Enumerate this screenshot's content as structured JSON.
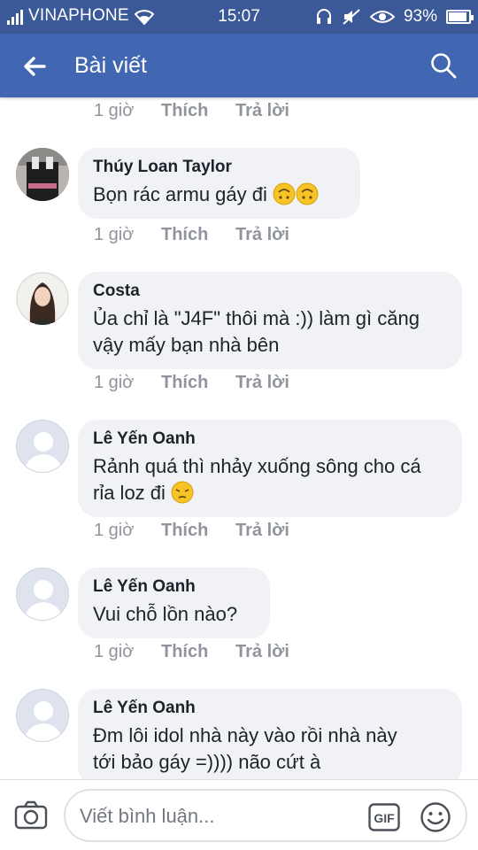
{
  "status_bar": {
    "carrier": "VINAPHONE",
    "time": "15:07",
    "battery": "93%",
    "battery_level": 0.93,
    "icons": [
      "signal-icon",
      "wifi-icon",
      "headset-icon",
      "mute-icon",
      "eye-icon",
      "battery-icon"
    ]
  },
  "header": {
    "title": "Bài viết",
    "back_icon": "back-arrow-icon",
    "search_icon": "search-icon"
  },
  "colors": {
    "status_bar": "#3b5998",
    "app_bar": "#4267b2",
    "bubble": "#f1f2f6",
    "meta_text": "#90949c"
  },
  "actions_labels": {
    "like": "Thích",
    "reply": "Trả lời"
  },
  "top_actions": {
    "time": "1 giờ",
    "like": "Thích",
    "reply": "Trả lời"
  },
  "comments": [
    {
      "name": "Thúy Loan Taylor",
      "lines": [
        "Bọn rác armu gáy đi"
      ],
      "emoji": "upside-down-face-emoji",
      "emoji_count": 2,
      "time": "1 giờ",
      "avatar": "photo"
    },
    {
      "name": "Costa",
      "lines": [
        "Ủa chỉ là \"J4F\" thôi mà :)) làm gì căng",
        "vậy mấy bạn nhà bên"
      ],
      "time": "1 giờ",
      "avatar": "photo"
    },
    {
      "name": "Lê Yến Oanh",
      "lines": [
        "Rảnh quá thì nhảy xuống sông cho cá",
        "rỉa loz đi"
      ],
      "emoji": "pensive-face-emoji",
      "emoji_count": 1,
      "time": "1 giờ",
      "avatar": "default"
    },
    {
      "name": "Lê Yến Oanh",
      "lines": [
        "Vui chỗ lồn nào?"
      ],
      "time": "1 giờ",
      "avatar": "default"
    },
    {
      "name": "Lê Yến Oanh",
      "lines": [
        "Đm lôi idol nhà này vào rồi nhà này",
        "tới bảo gáy =)))) não cứt à"
      ],
      "time": "",
      "avatar": "default"
    }
  ],
  "composer": {
    "placeholder": "Viết bình luận...",
    "camera_icon": "camera-icon",
    "gif_label": "GIF",
    "sticker_icon": "smiley-icon"
  }
}
